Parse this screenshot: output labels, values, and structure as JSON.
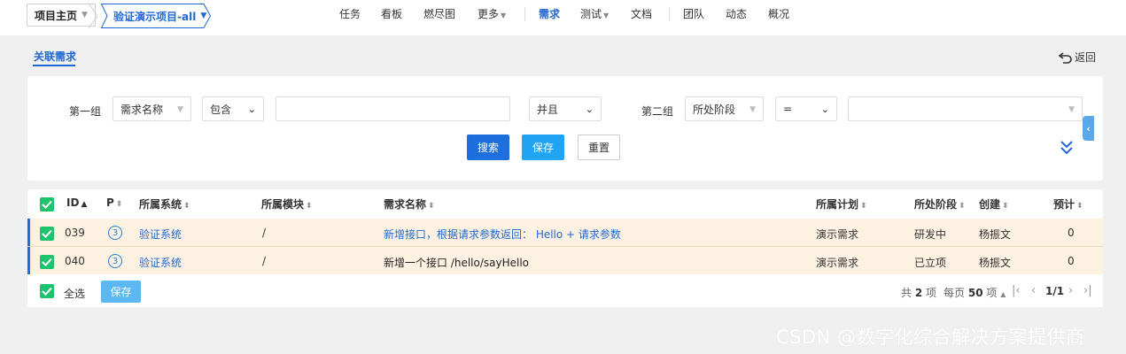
{
  "header": {
    "breadcrumb": [
      "项目主页",
      "验证演示项目-all"
    ],
    "nav_items": [
      {
        "label": "任务"
      },
      {
        "label": "看板"
      },
      {
        "label": "燃尽图"
      },
      {
        "label": "更多"
      },
      {
        "label": "需求",
        "active": true
      },
      {
        "label": "测试"
      },
      {
        "label": "文档"
      },
      {
        "label": "团队"
      },
      {
        "label": "动态"
      },
      {
        "label": "概况"
      }
    ]
  },
  "tab": {
    "label": "关联需求"
  },
  "back_label": "返回",
  "search": {
    "group1_label": "第一组",
    "group1_field": "需求名称",
    "group1_operator": "包含",
    "group1_value": "",
    "logic": "并且",
    "group2_label": "第二组",
    "group2_field": "所处阶段",
    "group2_operator": "=",
    "group2_value": "",
    "search_button": "搜索",
    "save_button": "保存",
    "reset_button": "重置"
  },
  "table": {
    "columns": [
      "ID",
      "P",
      "所属系统",
      "所属模块",
      "需求名称",
      "所属计划",
      "所处阶段",
      "创建",
      "预计"
    ],
    "rows": [
      {
        "id": "039",
        "priority": "3",
        "system": "验证系统",
        "module": "/",
        "name": "新增接口，根据请求参数返回： Hello + 请求参数",
        "plan": "演示需求",
        "stage": "研发中",
        "creator": "杨振文",
        "estimate": "0"
      },
      {
        "id": "040",
        "priority": "3",
        "system": "验证系统",
        "module": "/",
        "name": "新增一个接口 /hello/sayHello",
        "plan": "演示需求",
        "stage": "已立项",
        "creator": "杨振文",
        "estimate": "0"
      }
    ],
    "select_all_label": "全选",
    "save_label": "保存"
  },
  "pager": {
    "total_prefix": "共",
    "total": "2",
    "total_suffix": "项",
    "per_page_prefix": "每页",
    "per_page": "50",
    "per_page_suffix": "项",
    "page": "1/1"
  },
  "watermark": "CSDN @数字化综合解决方案提供商",
  "colors": {
    "accent": "#1d6fe0",
    "info": "#20a4f3",
    "check": "#1ec36d",
    "row_highlight": "#fdf2e2"
  }
}
